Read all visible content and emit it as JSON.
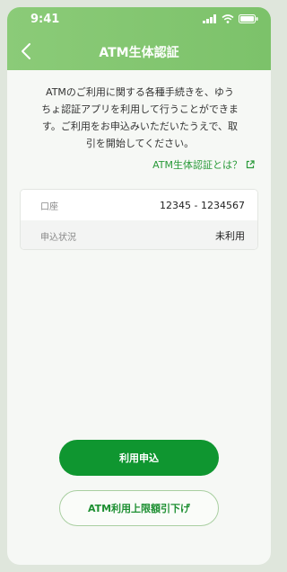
{
  "status_bar": {
    "time": "9:41"
  },
  "header": {
    "title": "ATM生体認証"
  },
  "icons": {
    "back": "chevron-left-icon",
    "signal": "signal-icon",
    "wifi": "wifi-icon",
    "battery": "battery-icon",
    "external": "external-link-icon"
  },
  "description": {
    "line1": "ATMのご利用に関する各種手続きを、ゆう",
    "line2": "ちょ認証アプリを利用して行うことができま",
    "line3": "す。ご利用をお申込みいただいたうえで、取",
    "line4": "引を開始してください。"
  },
  "help_link": {
    "label": "ATM生体認証とは？"
  },
  "info": {
    "rows": [
      {
        "label": "口座",
        "value": "12345 - 1234567"
      },
      {
        "label": "申込状況",
        "value": "未利用"
      }
    ]
  },
  "buttons": {
    "apply": "利用申込",
    "limit": "ATM利用上限額引下げ"
  },
  "colors": {
    "header": "#7cc26a",
    "primary": "#0f9630",
    "link": "#2a9a3a"
  }
}
